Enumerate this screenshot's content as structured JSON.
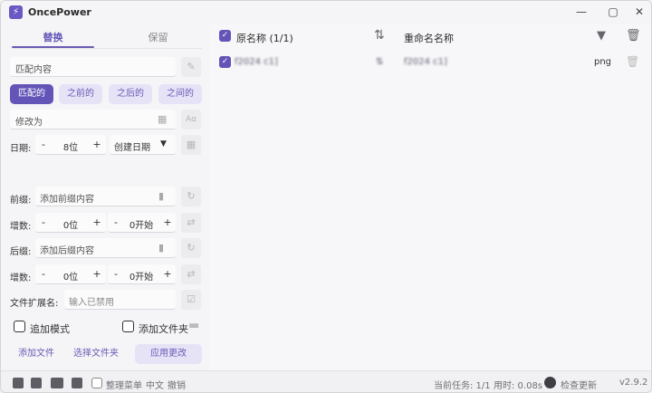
{
  "window": {
    "title": "OncePower",
    "controls": {
      "minimize": "—",
      "maximize": "▢",
      "close": "✕"
    }
  },
  "tabs": [
    {
      "label": "替换",
      "active": true
    },
    {
      "label": "保留",
      "active": false
    }
  ],
  "match": {
    "placeholder": "匹配内容"
  },
  "match_modes": [
    "匹配的",
    "之前的",
    "之后的",
    "之间的"
  ],
  "replace": {
    "placeholder": "修改为",
    "case_icon": "Aα"
  },
  "date": {
    "label": "日期:",
    "digits": "8位",
    "type": "创建日期"
  },
  "prefix": {
    "label": "前缀:",
    "placeholder": "添加前缀内容"
  },
  "increment1": {
    "label": "增数:",
    "digits": "0位",
    "start": "0开始"
  },
  "suffix": {
    "label": "后缀:",
    "placeholder": "添加后缀内容"
  },
  "increment2": {
    "label": "增数:",
    "digits": "0位",
    "start": "0开始"
  },
  "extension": {
    "label": "文件扩展名:",
    "placeholder": "输入已禁用"
  },
  "options": {
    "append_mode": "追加模式",
    "add_folder": "添加文件夹"
  },
  "actions": {
    "add_file": "添加文件",
    "select_folder": "选择文件夹",
    "apply": "应用更改"
  },
  "list": {
    "header_original": "原名称 (1/1)",
    "header_renamed": "重命名名称",
    "rows": [
      {
        "original": "f2024 c1]",
        "renamed": "f2024 c1]",
        "ext": "png",
        "arrow": "⇅"
      }
    ]
  },
  "status": {
    "organize_menu": "整理菜单",
    "language": "中文",
    "undo": "撤销",
    "current_task": "当前任务: 1/1",
    "elapsed": "用时: 0.08s",
    "check_update": "检查更新",
    "version": "v2.9.2"
  },
  "colors": {
    "accent": "#6355b7",
    "accent_light": "#e7e3f7"
  }
}
